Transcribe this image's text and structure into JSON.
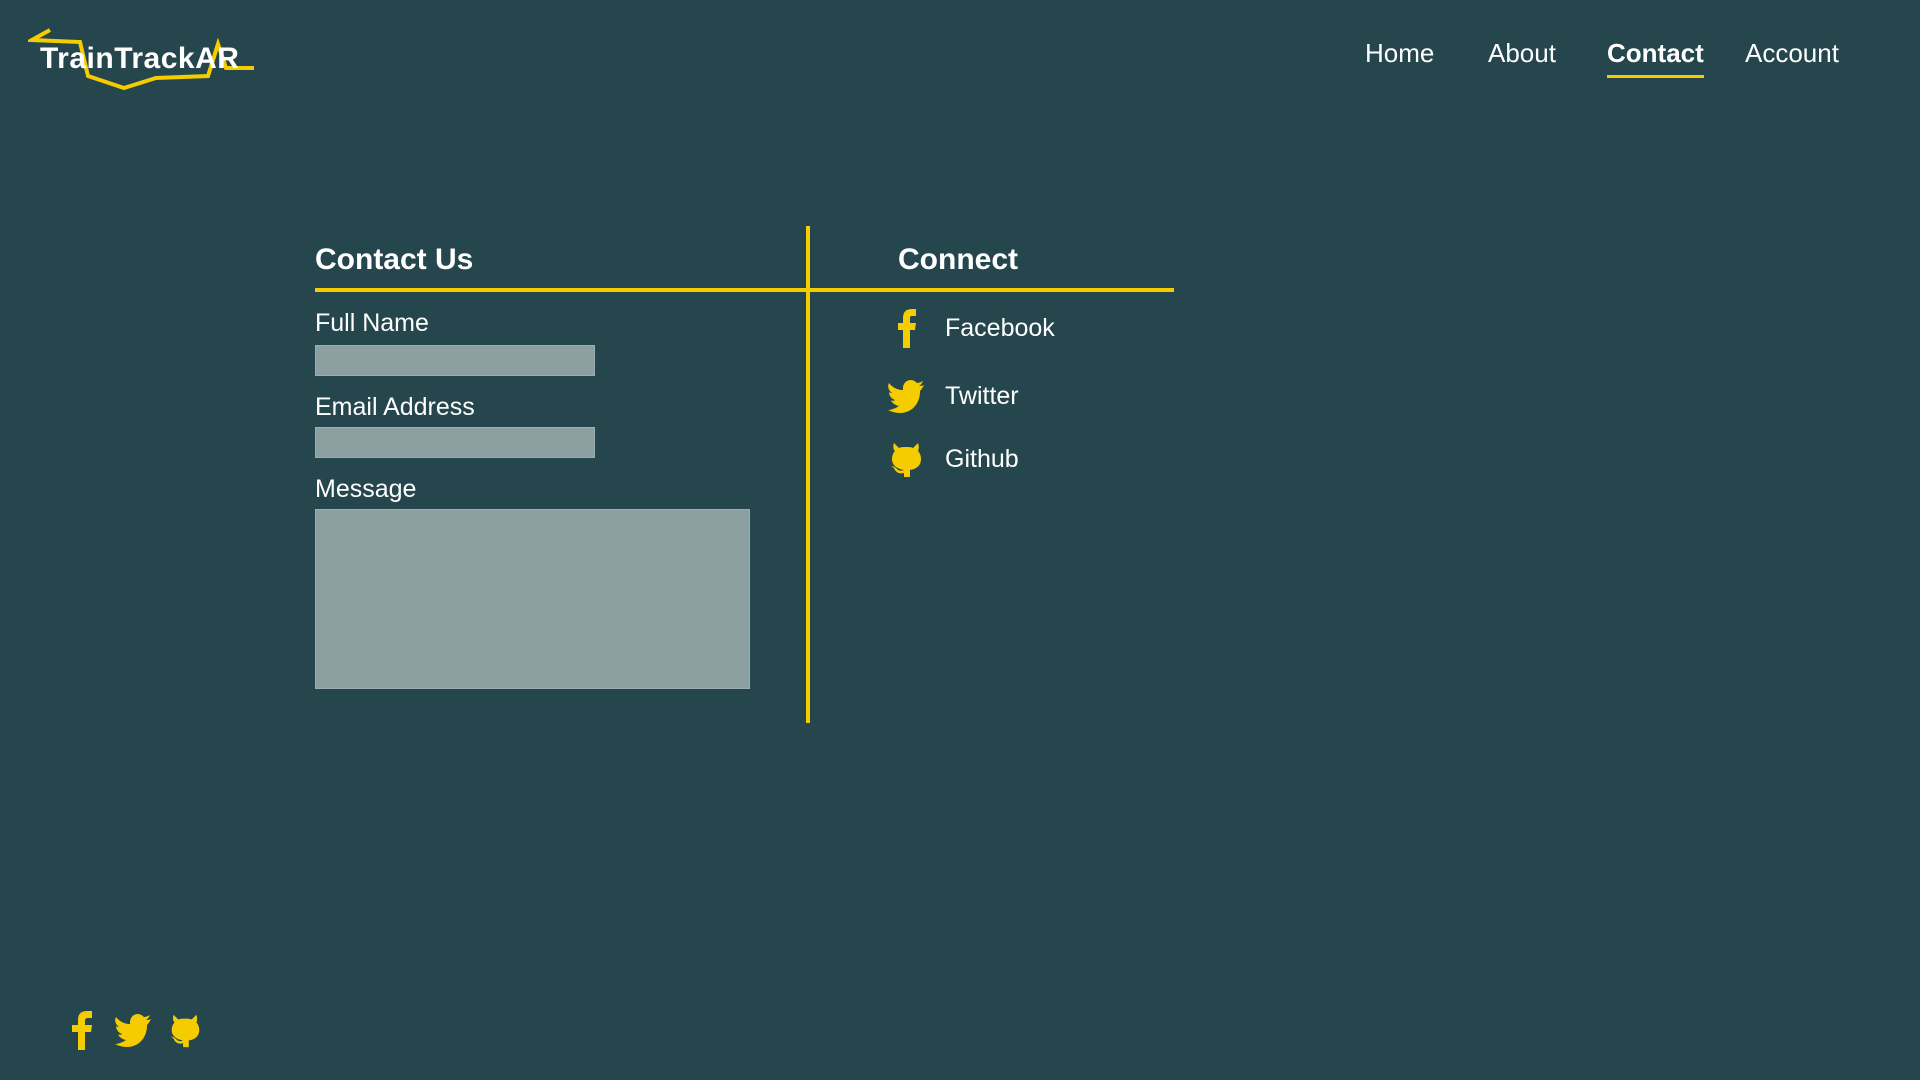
{
  "brand": {
    "logo_text": "TrainTrackAR"
  },
  "nav": {
    "items": [
      {
        "label": "Home"
      },
      {
        "label": "About"
      },
      {
        "label": "Contact",
        "active": true
      },
      {
        "label": "Account"
      }
    ]
  },
  "contact": {
    "heading": "Contact Us",
    "fields": {
      "name_label": "Full Name",
      "name_value": "",
      "email_label": "Email Address",
      "email_value": "",
      "message_label": "Message",
      "message_value": ""
    }
  },
  "connect": {
    "heading": "Connect",
    "links": [
      {
        "label": "Facebook",
        "icon": "facebook-icon"
      },
      {
        "label": "Twitter",
        "icon": "twitter-icon"
      },
      {
        "label": "Github",
        "icon": "github-icon"
      }
    ]
  },
  "footer": {
    "icons": [
      "facebook-icon",
      "twitter-icon",
      "github-icon"
    ]
  },
  "colors": {
    "background": "#25464c",
    "accent": "#f5cc00",
    "input_fill": "#8ca0a2",
    "text": "#ffffff"
  }
}
